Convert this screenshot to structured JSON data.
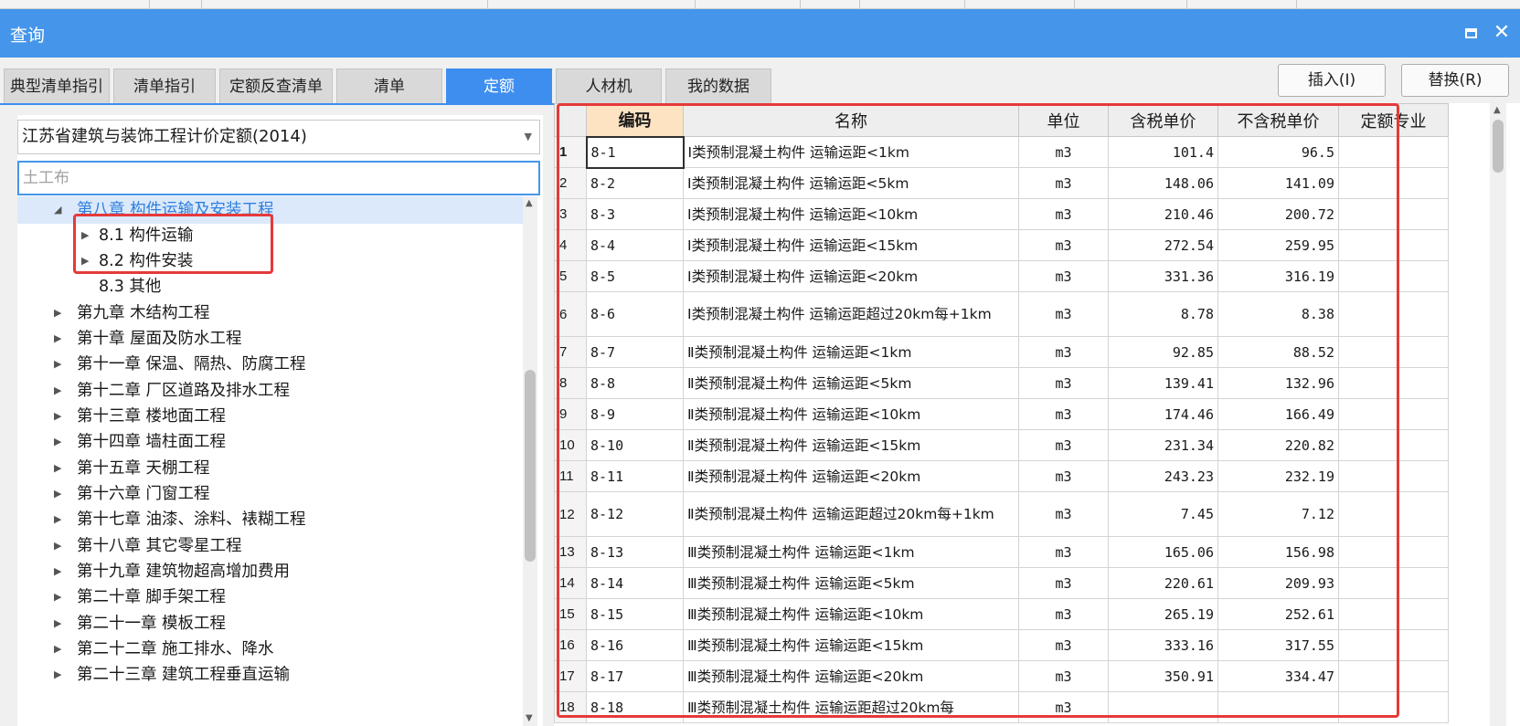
{
  "window": {
    "title": "查询",
    "maximize_icon": "maximize-icon",
    "close_icon": "close-icon",
    "close_glyph": "✕"
  },
  "tabs": [
    {
      "label": "典型清单指引",
      "active": false
    },
    {
      "label": "清单指引",
      "active": false
    },
    {
      "label": "定额反查清单",
      "active": false
    },
    {
      "label": "清单",
      "active": false
    },
    {
      "label": "定额",
      "active": true
    },
    {
      "label": "人材机",
      "active": false
    },
    {
      "label": "我的数据",
      "active": false
    }
  ],
  "actions": {
    "insert_label": "插入(I)",
    "replace_label": "替换(R)"
  },
  "left": {
    "quota_library": "江苏省建筑与装饰工程计价定额(2014)",
    "search_placeholder": "土工布",
    "tree": [
      {
        "label": "第八章 构件运输及安装工程",
        "level": 0,
        "expanded": true,
        "selected": true
      },
      {
        "label": "8.1 构件运输",
        "level": 1,
        "expanded": false
      },
      {
        "label": "8.2 构件安装",
        "level": 1,
        "expanded": false
      },
      {
        "label": "8.3 其他",
        "level": 1,
        "leaf": true
      },
      {
        "label": "第九章 木结构工程",
        "level": 0
      },
      {
        "label": "第十章 屋面及防水工程",
        "level": 0
      },
      {
        "label": "第十一章 保温、隔热、防腐工程",
        "level": 0
      },
      {
        "label": "第十二章 厂区道路及排水工程",
        "level": 0
      },
      {
        "label": "第十三章 楼地面工程",
        "level": 0
      },
      {
        "label": "第十四章 墙柱面工程",
        "level": 0
      },
      {
        "label": "第十五章 天棚工程",
        "level": 0
      },
      {
        "label": "第十六章 门窗工程",
        "level": 0
      },
      {
        "label": "第十七章 油漆、涂料、裱糊工程",
        "level": 0
      },
      {
        "label": "第十八章 其它零星工程",
        "level": 0
      },
      {
        "label": "第十九章 建筑物超高增加费用",
        "level": 0
      },
      {
        "label": "第二十章 脚手架工程",
        "level": 0
      },
      {
        "label": "第二十一章 模板工程",
        "level": 0
      },
      {
        "label": "第二十二章 施工排水、降水",
        "level": 0
      },
      {
        "label": "第二十三章 建筑工程垂直运输",
        "level": 0
      }
    ]
  },
  "grid": {
    "columns": [
      "编码",
      "名称",
      "单位",
      "含税单价",
      "不含税单价",
      "定额专业"
    ],
    "rows": [
      {
        "no": "1",
        "code": "8-1",
        "name": "Ⅰ类预制混凝土构件 运输运距<1km",
        "unit": "m3",
        "tax_price": "101.4",
        "notax_price": "96.5",
        "major": ""
      },
      {
        "no": "2",
        "code": "8-2",
        "name": "Ⅰ类预制混凝土构件 运输运距<5km",
        "unit": "m3",
        "tax_price": "148.06",
        "notax_price": "141.09",
        "major": ""
      },
      {
        "no": "3",
        "code": "8-3",
        "name": "Ⅰ类预制混凝土构件 运输运距<10km",
        "unit": "m3",
        "tax_price": "210.46",
        "notax_price": "200.72",
        "major": ""
      },
      {
        "no": "4",
        "code": "8-4",
        "name": "Ⅰ类预制混凝土构件 运输运距<15km",
        "unit": "m3",
        "tax_price": "272.54",
        "notax_price": "259.95",
        "major": ""
      },
      {
        "no": "5",
        "code": "8-5",
        "name": "Ⅰ类预制混凝土构件 运输运距<20km",
        "unit": "m3",
        "tax_price": "331.36",
        "notax_price": "316.19",
        "major": ""
      },
      {
        "no": "6",
        "code": "8-6",
        "name": "Ⅰ类预制混凝土构件 运输运距超过20km每+1km",
        "unit": "m3",
        "tax_price": "8.78",
        "notax_price": "8.38",
        "major": ""
      },
      {
        "no": "7",
        "code": "8-7",
        "name": "Ⅱ类预制混凝土构件 运输运距<1km",
        "unit": "m3",
        "tax_price": "92.85",
        "notax_price": "88.52",
        "major": ""
      },
      {
        "no": "8",
        "code": "8-8",
        "name": "Ⅱ类预制混凝土构件 运输运距<5km",
        "unit": "m3",
        "tax_price": "139.41",
        "notax_price": "132.96",
        "major": ""
      },
      {
        "no": "9",
        "code": "8-9",
        "name": "Ⅱ类预制混凝土构件 运输运距<10km",
        "unit": "m3",
        "tax_price": "174.46",
        "notax_price": "166.49",
        "major": ""
      },
      {
        "no": "10",
        "code": "8-10",
        "name": "Ⅱ类预制混凝土构件 运输运距<15km",
        "unit": "m3",
        "tax_price": "231.34",
        "notax_price": "220.82",
        "major": ""
      },
      {
        "no": "11",
        "code": "8-11",
        "name": "Ⅱ类预制混凝土构件 运输运距<20km",
        "unit": "m3",
        "tax_price": "243.23",
        "notax_price": "232.19",
        "major": ""
      },
      {
        "no": "12",
        "code": "8-12",
        "name": "Ⅱ类预制混凝土构件 运输运距超过20km每+1km",
        "unit": "m3",
        "tax_price": "7.45",
        "notax_price": "7.12",
        "major": ""
      },
      {
        "no": "13",
        "code": "8-13",
        "name": "Ⅲ类预制混凝土构件 运输运距<1km",
        "unit": "m3",
        "tax_price": "165.06",
        "notax_price": "156.98",
        "major": ""
      },
      {
        "no": "14",
        "code": "8-14",
        "name": "Ⅲ类预制混凝土构件 运输运距<5km",
        "unit": "m3",
        "tax_price": "220.61",
        "notax_price": "209.93",
        "major": ""
      },
      {
        "no": "15",
        "code": "8-15",
        "name": "Ⅲ类预制混凝土构件 运输运距<10km",
        "unit": "m3",
        "tax_price": "265.19",
        "notax_price": "252.61",
        "major": ""
      },
      {
        "no": "16",
        "code": "8-16",
        "name": "Ⅲ类预制混凝土构件 运输运距<15km",
        "unit": "m3",
        "tax_price": "333.16",
        "notax_price": "317.55",
        "major": ""
      },
      {
        "no": "17",
        "code": "8-17",
        "name": "Ⅲ类预制混凝土构件 运输运距<20km",
        "unit": "m3",
        "tax_price": "350.91",
        "notax_price": "334.47",
        "major": ""
      },
      {
        "no": "18",
        "code": "8-18",
        "name": "Ⅲ类预制混凝土构件 运输运距超过20km每",
        "unit": "m3",
        "tax_price": "",
        "notax_price": "",
        "major": ""
      }
    ]
  },
  "colors": {
    "titlebar": "#4596ea",
    "active_tab": "#3e8ef0",
    "highlight_box": "#e53a3a",
    "code_header": "#fde3c2"
  }
}
